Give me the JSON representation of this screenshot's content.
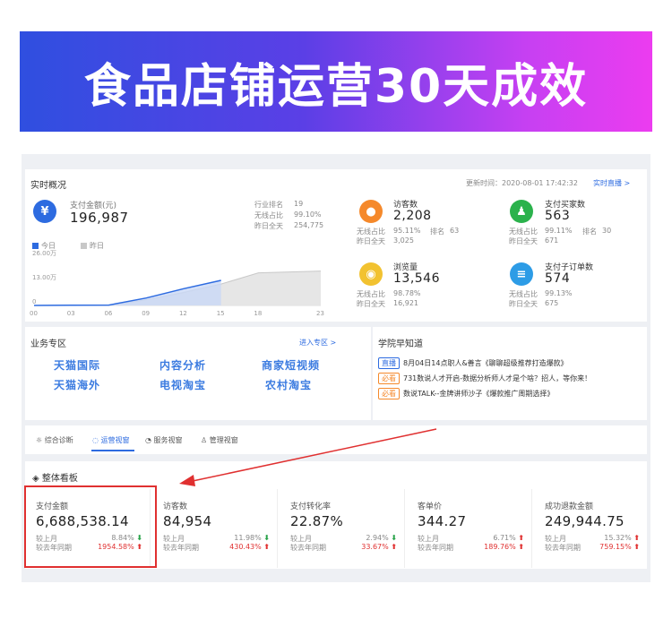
{
  "banner": {
    "title": "食品店铺运营30天成效"
  },
  "realtime": {
    "title": "实时概况",
    "update_time": "更新时间：2020-08-01 17:42:32",
    "live_link": "实时直播 >",
    "pay": {
      "label": "支付金额(元)",
      "value": "196,987",
      "rank_label": "行业排名",
      "rank": "19",
      "wireless_label": "无线占比",
      "wireless": "99.10%",
      "yesterday_label": "昨日全天",
      "yesterday": "254,775"
    },
    "legend_today": "今日",
    "legend_yesterday": "昨日",
    "chart_data": {
      "type": "area",
      "x": [
        "00",
        "03",
        "06",
        "09",
        "12",
        "15",
        "18",
        "23"
      ],
      "ytick_labels": [
        "26.00万",
        "13.00万",
        "0"
      ],
      "series": [
        {
          "name": "今日",
          "values": [
            0,
            0.1,
            0.2,
            4,
            9,
            13.5,
            null,
            null
          ]
        },
        {
          "name": "昨日",
          "values": [
            0,
            0.1,
            0.2,
            3,
            7,
            11.5,
            17.5,
            18.5
          ]
        }
      ]
    },
    "visitors": {
      "label": "访客数",
      "value": "2,208",
      "l1": "无线占比",
      "v1": "95.11%",
      "l1b": "排名",
      "v1b": "63",
      "l2": "昨日全天",
      "v2": "3,025"
    },
    "buyers": {
      "label": "支付买家数",
      "value": "563",
      "l1": "无线占比",
      "v1": "99.11%",
      "l1b": "排名",
      "v1b": "30",
      "l2": "昨日全天",
      "v2": "671"
    },
    "pageviews": {
      "label": "浏览量",
      "value": "13,546",
      "l1": "无线占比",
      "v1": "98.78%",
      "l2": "昨日全天",
      "v2": "16,921"
    },
    "orders": {
      "label": "支付子订单数",
      "value": "574",
      "l1": "无线占比",
      "v1": "99.13%",
      "l2": "昨日全天",
      "v2": "675"
    }
  },
  "business": {
    "title": "业务专区",
    "enter": "进入专区 >",
    "items": [
      "天猫国际",
      "内容分析",
      "商家短视频",
      "天猫海外",
      "电视淘宝",
      "农村淘宝"
    ]
  },
  "academy": {
    "title": "学院早知道",
    "news": [
      {
        "tag": "直播",
        "text": "8月04日14点职人&善言《聊聊超级推荐打造爆款》"
      },
      {
        "tag": "必看",
        "text": "731数说人才开启-数据分析师人才是个啥？招人，等你来！"
      },
      {
        "tag": "必看",
        "text": "数说TALK--金牌讲师沙子《爆款推广周期选择》"
      }
    ]
  },
  "tabs": [
    "综合诊断",
    "运营视窗",
    "服务视窗",
    "管理视窗"
  ],
  "board": {
    "title": "整体看板",
    "cards": [
      {
        "label": "支付金额",
        "value": "6,688,538.14",
        "c1": "较上月",
        "r1": "8.84%",
        "d1": "down",
        "c2": "较去年同期",
        "r2": "1954.58%",
        "d2": "up"
      },
      {
        "label": "访客数",
        "value": "84,954",
        "c1": "较上月",
        "r1": "11.98%",
        "d1": "down",
        "c2": "较去年同期",
        "r2": "430.43%",
        "d2": "up"
      },
      {
        "label": "支付转化率",
        "value": "22.87%",
        "c1": "较上月",
        "r1": "2.94%",
        "d1": "down",
        "c2": "较去年同期",
        "r2": "33.67%",
        "d2": "up"
      },
      {
        "label": "客单价",
        "value": "344.27",
        "c1": "较上月",
        "r1": "6.71%",
        "d1": "up",
        "c2": "较去年同期",
        "r2": "189.76%",
        "d2": "up"
      },
      {
        "label": "成功退款金额",
        "value": "249,944.75",
        "c1": "较上月",
        "r1": "15.32%",
        "d1": "up",
        "c2": "较去年同期",
        "r2": "759.15%",
        "d2": "up"
      }
    ]
  },
  "colors": {
    "accent": "#2d6be0",
    "highlight": "#e03030",
    "visitor_icon": "#f5892b",
    "buyer_icon": "#2bb24c",
    "pv_icon": "#f2c230",
    "order_icon": "#2d9ce6"
  }
}
